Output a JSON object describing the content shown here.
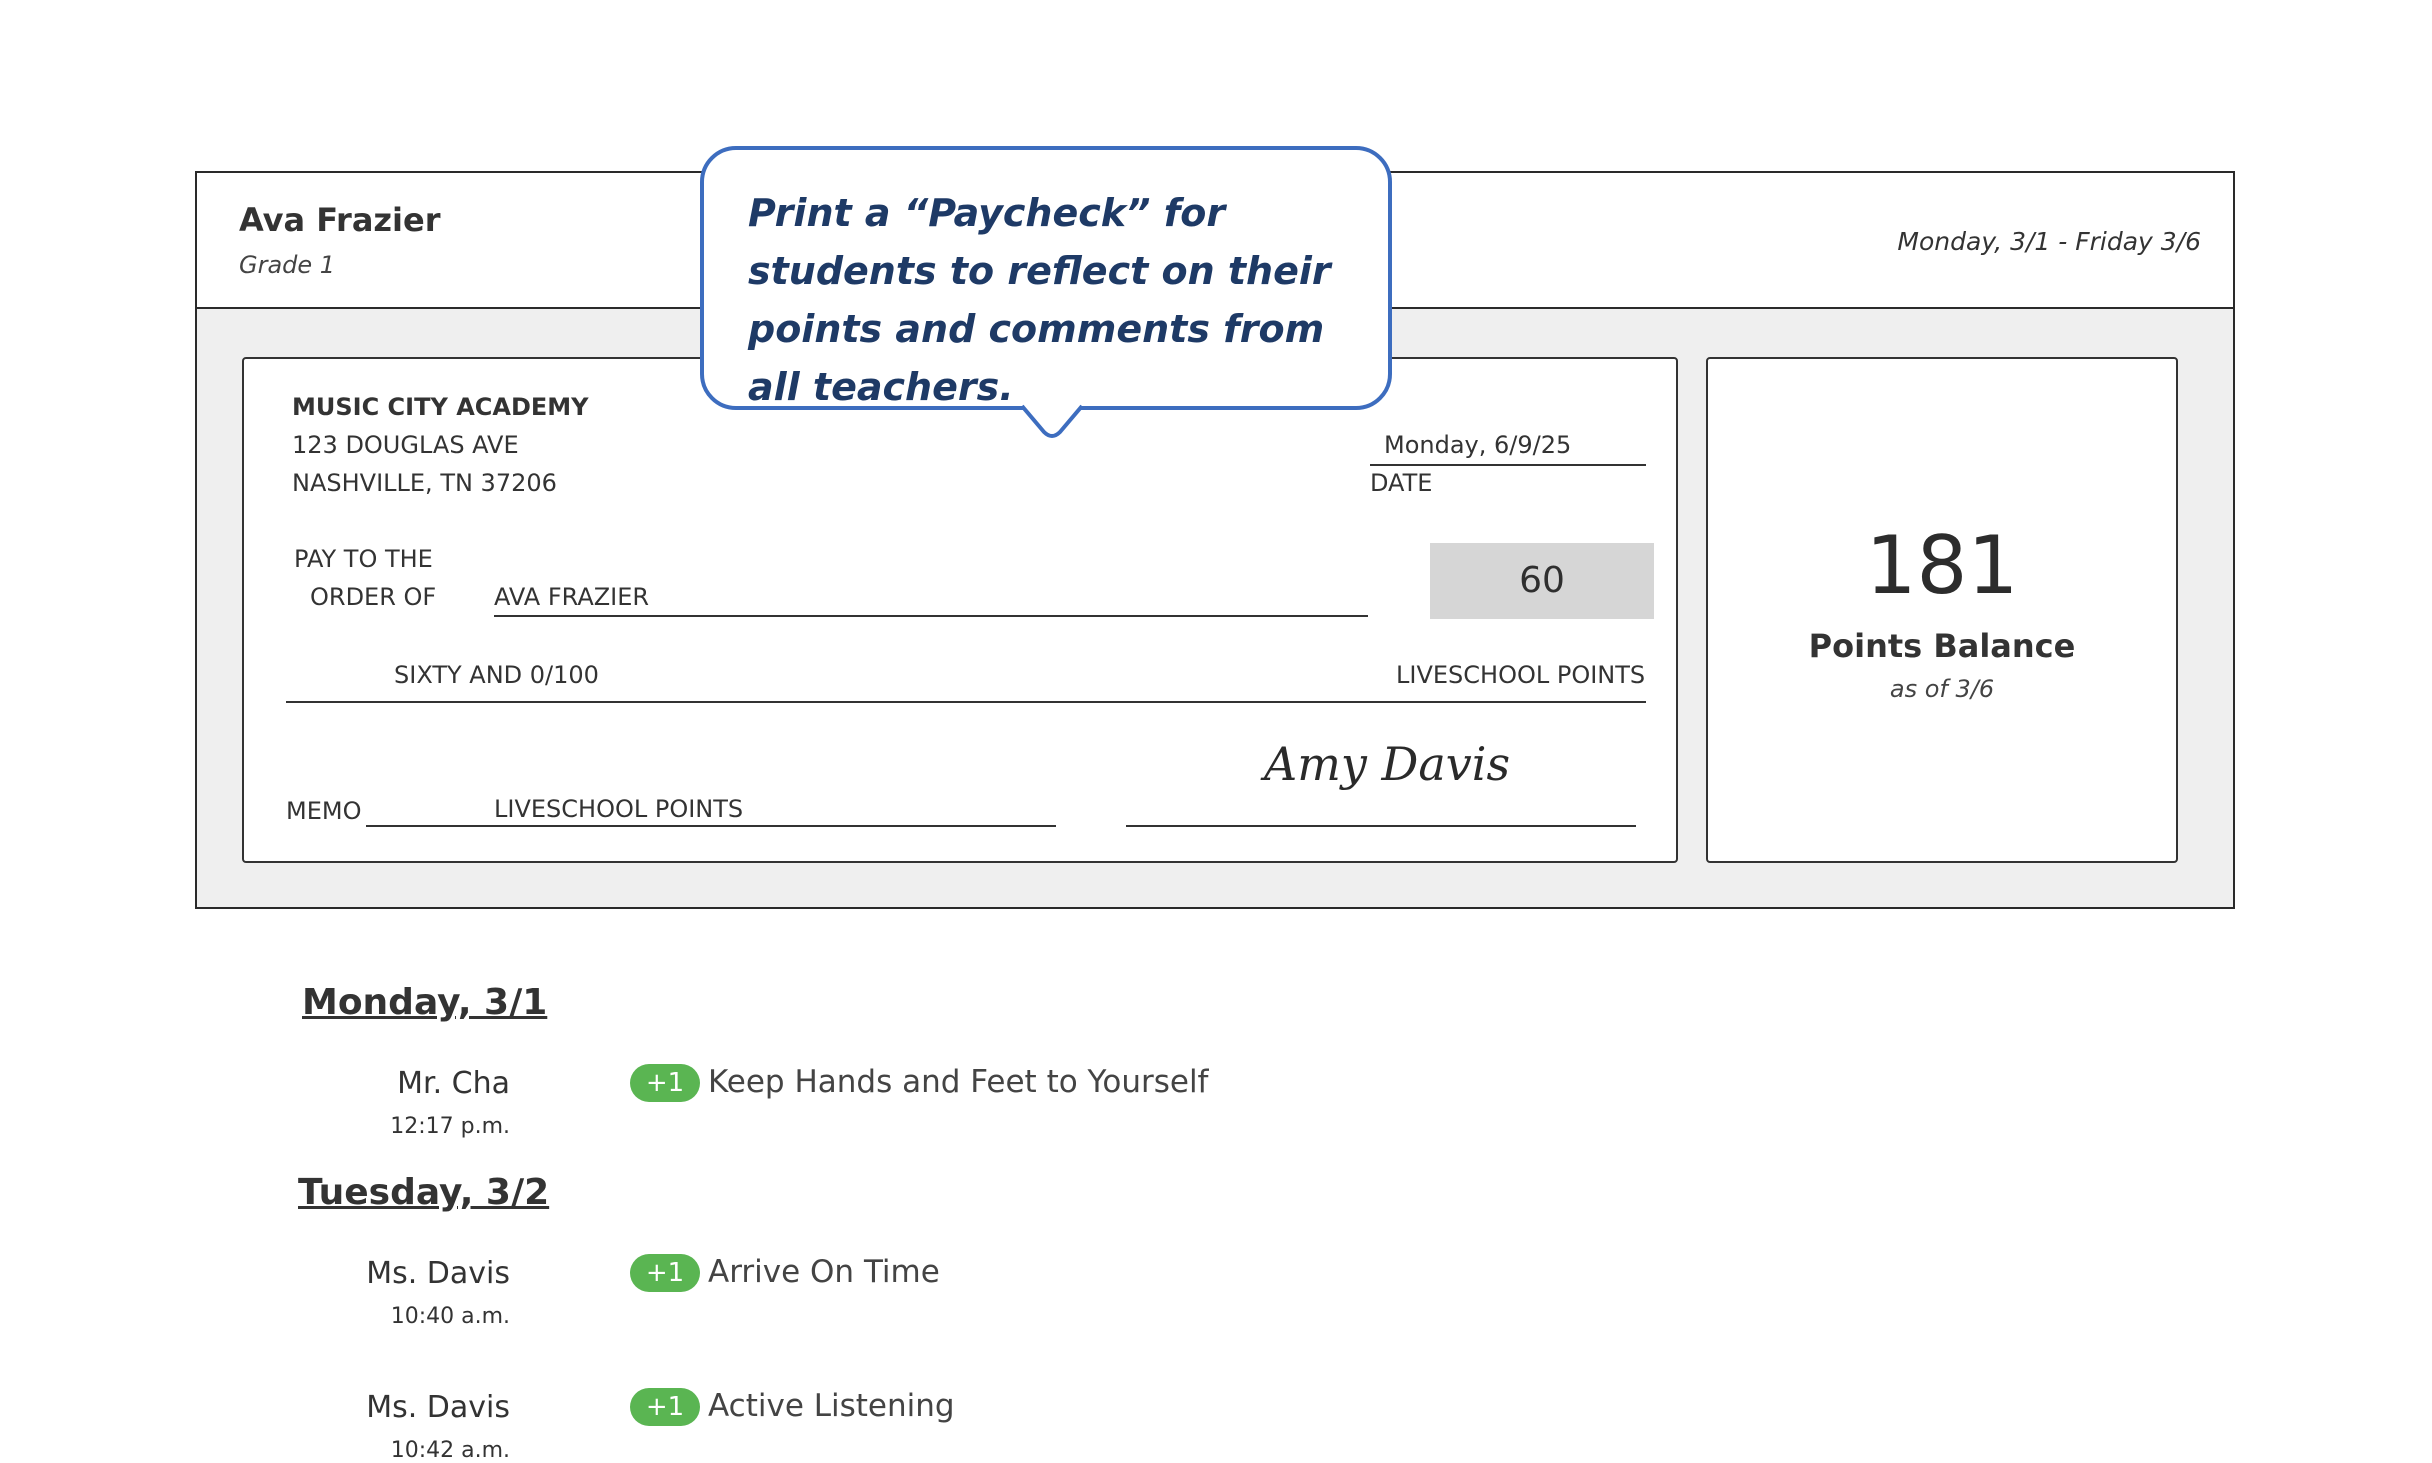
{
  "header": {
    "student_name": "Ava Frazier",
    "grade": "Grade 1",
    "date_range": "Monday, 3/1 - Friday 3/6"
  },
  "callout": {
    "text": "Print a “Paycheck” for students to reflect on their points and comments from all teachers."
  },
  "check": {
    "school_name": "MUSIC CITY ACADEMY",
    "address_line1": "123 DOUGLAS AVE",
    "address_line2": "NASHVILLE, TN 37206",
    "date_value": "Monday, 6/9/25",
    "date_label": "DATE",
    "pay_to_line1": "PAY TO THE",
    "pay_to_line2": "ORDER OF",
    "payee": "AVA FRAZIER",
    "amount": "60",
    "amount_words": "SIXTY AND 0/100",
    "currency": "LIVESCHOOL POINTS",
    "memo_label": "MEMO",
    "memo_value": "LIVESCHOOL POINTS",
    "signature": "Amy Davis"
  },
  "balance": {
    "value": "181",
    "label": "Points Balance",
    "as_of": "as of 3/6"
  },
  "days": [
    {
      "heading": "Monday, 3/1",
      "entries": [
        {
          "teacher": "Mr. Cha",
          "time": "12:17 p.m.",
          "points": "+1",
          "behavior": "Keep Hands and Feet to Yourself"
        }
      ]
    },
    {
      "heading": "Tuesday, 3/2",
      "entries": [
        {
          "teacher": "Ms. Davis",
          "time": "10:40 a.m.",
          "points": "+1",
          "behavior": "Arrive On Time"
        },
        {
          "teacher": "Ms. Davis",
          "time": "10:42 a.m.",
          "points": "+1",
          "behavior": "Active Listening"
        }
      ]
    }
  ],
  "colors": {
    "badge_green": "#5ab552",
    "callout_border": "#3d6dbf",
    "callout_text": "#1e3a66",
    "card_bg": "#efefef"
  }
}
